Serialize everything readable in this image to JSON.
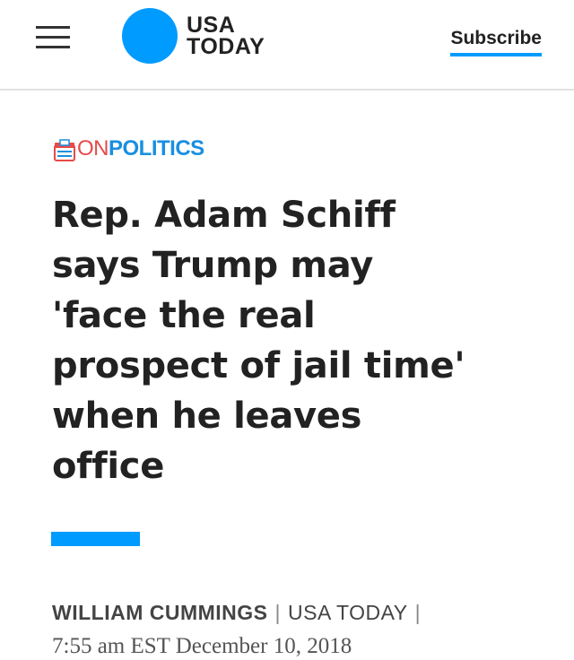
{
  "header": {
    "logo_line1": "USA",
    "logo_line2": "TODAY",
    "subscribe_label": "Subscribe"
  },
  "section": {
    "prefix": "ON",
    "name": "POLITICS"
  },
  "article": {
    "headline_lines": [
      "Rep. Adam Schiff",
      "says Trump may",
      "'face the real",
      "prospect of jail time'",
      "when he leaves",
      "office"
    ],
    "author": "WILLIAM CUMMINGS",
    "separator": "|",
    "outlet": "USA TODAY",
    "timestamp": "7:55 am EST December 10, 2018"
  },
  "icons": {
    "menu": "hamburger-menu-icon",
    "section": "ballot-box-icon"
  },
  "colors": {
    "brand_blue": "#009bff",
    "on_red": "#e64a4a",
    "politics_blue": "#1a8fe0",
    "text_dark": "#222222"
  }
}
